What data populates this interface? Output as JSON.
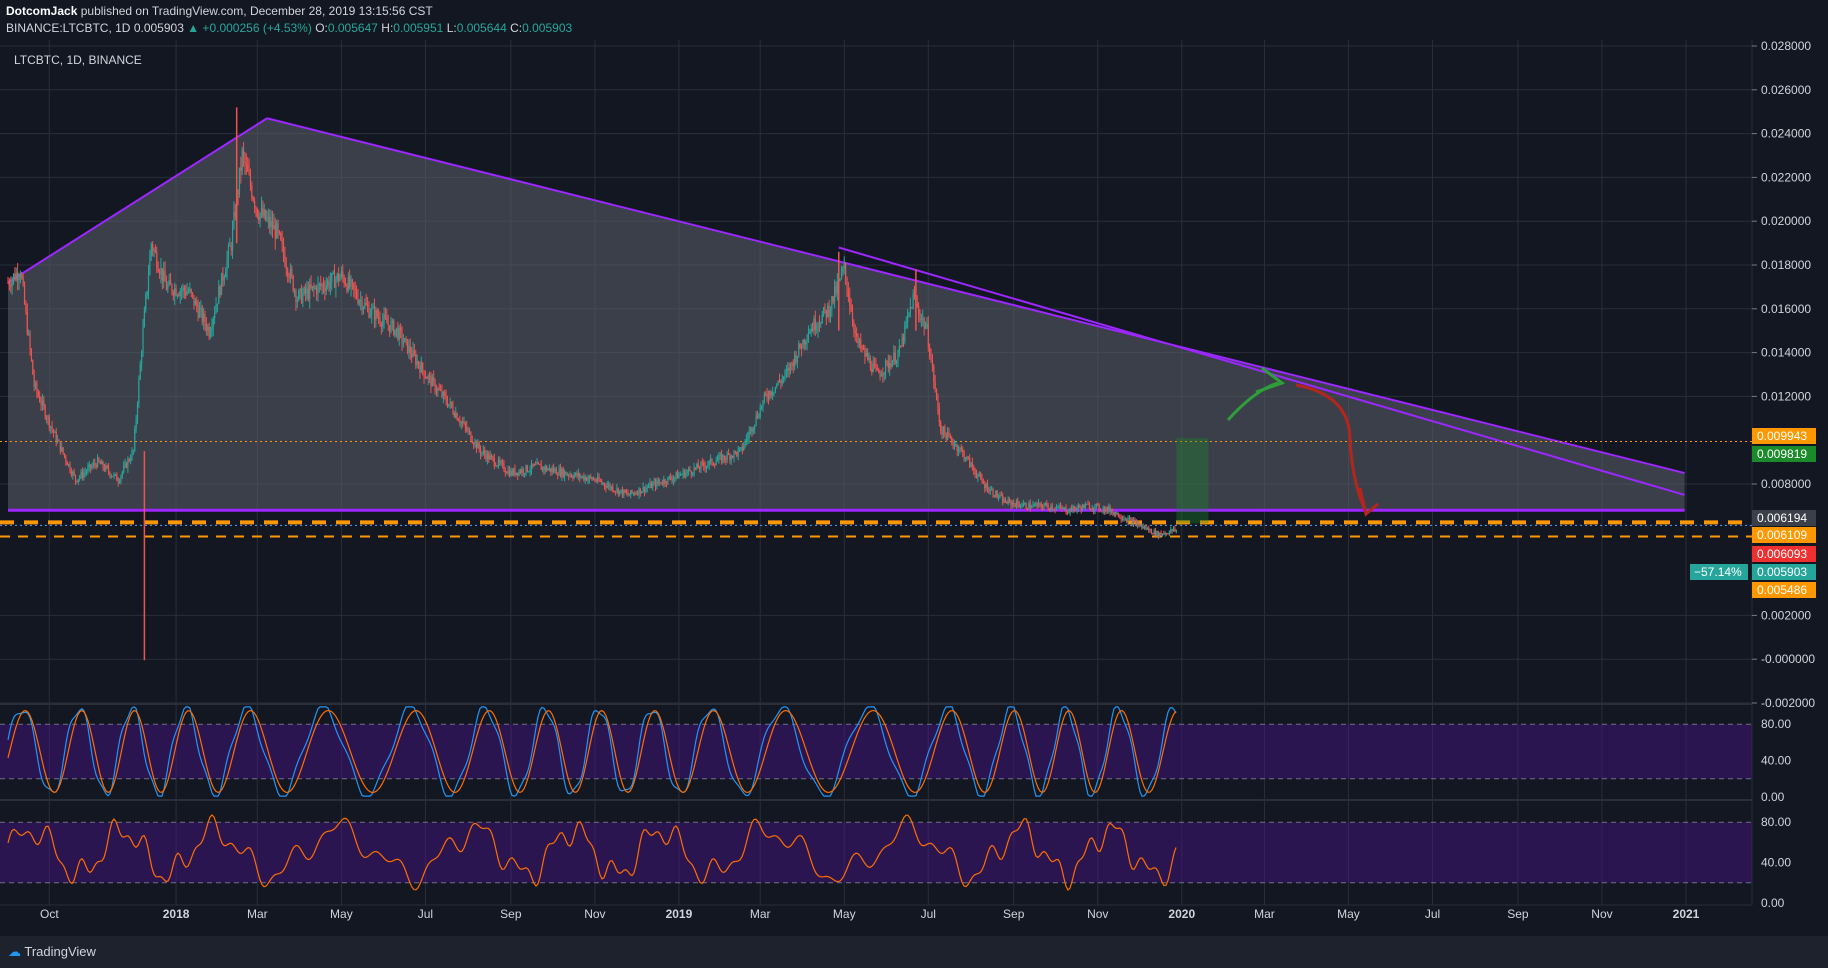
{
  "header": {
    "author": "DotcomJack",
    "published_text": "published on TradingView.com, December 28, 2019 13:15:56 CST",
    "symbol_line": "BINANCE:LTCBTC, 1D",
    "last_price": "0.005903",
    "change": "▲ +0.000256 (+4.53%)",
    "o_label": "O:",
    "o_value": "0.005647",
    "h_label": "H:",
    "h_value": "0.005951",
    "l_label": "L:",
    "l_value": "0.005644",
    "c_label": "C:",
    "c_value": "0.005903"
  },
  "legend": {
    "pane_title": "LTCBTC, 1D, BINANCE"
  },
  "footer": {
    "brand": "TradingView"
  },
  "colors": {
    "background": "#131722",
    "grid": "#2a2e39",
    "triangle_line": "#9c27ff",
    "triangle_fill": "#5d606b",
    "orange": "#ff9800",
    "up": "#26a69a",
    "down": "#ef5350",
    "stoch_k": "#2196f3",
    "stoch_d": "#ff6d00",
    "rsi": "#ff6d00",
    "band": "#4a148c"
  },
  "chart_data": [
    {
      "type": "candlestick",
      "title": "LTCBTC, 1D, BINANCE",
      "ylim": [
        -0.002,
        0.028
      ],
      "y_ticks": [
        "0.028000",
        "0.026000",
        "0.024000",
        "0.022000",
        "0.020000",
        "0.018000",
        "0.016000",
        "0.014000",
        "0.012000",
        "0.008000",
        "0.002000",
        "-0.000000",
        "-0.002000"
      ],
      "x_ticks": [
        "Oct",
        "2018",
        "Mar",
        "May",
        "Jul",
        "Sep",
        "Nov",
        "2019",
        "Mar",
        "May",
        "Jul",
        "Sep",
        "Nov",
        "2020",
        "Mar",
        "May",
        "Jul",
        "Sep",
        "Nov",
        "2021"
      ],
      "x_tick_dates": [
        "2017-10-01",
        "2018-01-01",
        "2018-03-01",
        "2018-05-01",
        "2018-07-01",
        "2018-09-01",
        "2018-11-01",
        "2019-01-01",
        "2019-03-01",
        "2019-05-01",
        "2019-07-01",
        "2019-09-01",
        "2019-11-01",
        "2020-01-01",
        "2020-03-01",
        "2020-05-01",
        "2020-07-01",
        "2020-09-01",
        "2020-11-01",
        "2021-01-01"
      ],
      "price_path": [
        [
          "2017-09-01",
          0.0172
        ],
        [
          "2017-09-10",
          0.0178
        ],
        [
          "2017-09-20",
          0.0125
        ],
        [
          "2017-10-05",
          0.0102
        ],
        [
          "2017-10-20",
          0.0082
        ],
        [
          "2017-11-05",
          0.009
        ],
        [
          "2017-11-20",
          0.0082
        ],
        [
          "2017-12-01",
          0.0095
        ],
        [
          "2017-12-08",
          0.015
        ],
        [
          "2017-12-14",
          0.019
        ],
        [
          "2017-12-25",
          0.017
        ],
        [
          "2018-01-10",
          0.0168
        ],
        [
          "2018-01-25",
          0.015
        ],
        [
          "2018-02-10",
          0.019
        ],
        [
          "2018-02-18",
          0.023
        ],
        [
          "2018-03-01",
          0.0205
        ],
        [
          "2018-03-15",
          0.0195
        ],
        [
          "2018-03-30",
          0.0165
        ],
        [
          "2018-04-15",
          0.017
        ],
        [
          "2018-05-01",
          0.0175
        ],
        [
          "2018-05-20",
          0.016
        ],
        [
          "2018-06-10",
          0.015
        ],
        [
          "2018-07-01",
          0.013
        ],
        [
          "2018-07-20",
          0.0115
        ],
        [
          "2018-08-10",
          0.0095
        ],
        [
          "2018-09-01",
          0.0085
        ],
        [
          "2018-09-20",
          0.0088
        ],
        [
          "2018-10-10",
          0.0085
        ],
        [
          "2018-11-01",
          0.0082
        ],
        [
          "2018-11-25",
          0.0075
        ],
        [
          "2018-12-15",
          0.008
        ],
        [
          "2019-01-05",
          0.0085
        ],
        [
          "2019-01-25",
          0.009
        ],
        [
          "2019-02-15",
          0.0095
        ],
        [
          "2019-03-05",
          0.012
        ],
        [
          "2019-03-20",
          0.013
        ],
        [
          "2019-04-05",
          0.015
        ],
        [
          "2019-04-20",
          0.016
        ],
        [
          "2019-05-01",
          0.0178
        ],
        [
          "2019-05-10",
          0.0145
        ],
        [
          "2019-05-25",
          0.013
        ],
        [
          "2019-06-10",
          0.014
        ],
        [
          "2019-06-20",
          0.0165
        ],
        [
          "2019-06-30",
          0.015
        ],
        [
          "2019-07-10",
          0.0105
        ],
        [
          "2019-07-25",
          0.0095
        ],
        [
          "2019-08-10",
          0.008
        ],
        [
          "2019-08-25",
          0.0072
        ],
        [
          "2019-09-10",
          0.007
        ],
        [
          "2019-09-25",
          0.007
        ],
        [
          "2019-10-10",
          0.0068
        ],
        [
          "2019-10-25",
          0.007
        ],
        [
          "2019-11-10",
          0.0068
        ],
        [
          "2019-11-25",
          0.0063
        ],
        [
          "2019-12-15",
          0.0057
        ],
        [
          "2019-12-28",
          0.005903
        ]
      ],
      "spikes": [
        {
          "date": "2017-12-09",
          "low": -5e-05,
          "high": 0.0095
        },
        {
          "date": "2018-02-14",
          "low": 0.019,
          "high": 0.0252
        },
        {
          "date": "2019-04-27",
          "low": 0.015,
          "high": 0.0186
        },
        {
          "date": "2019-06-22",
          "low": 0.015,
          "high": 0.0178
        }
      ],
      "triangle": {
        "vertices": [
          [
            "2017-09-01",
            0.0172
          ],
          [
            "2018-03-08",
            0.0247
          ],
          [
            "2020-12-31",
            0.0085
          ],
          [
            "2020-12-31",
            0.0068
          ],
          [
            "2017-09-01",
            0.0068
          ]
        ],
        "upper_inner_trendline": [
          [
            "2019-04-27",
            0.0188
          ],
          [
            "2020-12-31",
            0.0075
          ]
        ],
        "support_line": [
          [
            "2017-09-01",
            0.0068
          ],
          [
            "2020-12-31",
            0.0068
          ]
        ]
      },
      "horizontal_lines": [
        {
          "price": 0.009943,
          "style": "dotted",
          "color": "#ff9800"
        },
        {
          "price": 0.00625,
          "style": "dashed-thick",
          "color": "#ff9800"
        },
        {
          "price": 0.006109,
          "style": "dotted",
          "color": "#5b9cf6"
        },
        {
          "price": 0.0056,
          "style": "dashed",
          "color": "#ff9800"
        }
      ],
      "price_labels": [
        {
          "text": "0.009943",
          "bg": "#ff9800",
          "fg": "#ffffff",
          "price": 0.009943
        },
        {
          "text": "0.009819",
          "bg": "#1b8a2a",
          "fg": "#ffffff",
          "price": 0.009819
        },
        {
          "text": "0.006194",
          "bg": "#3b3f4a",
          "fg": "#ffffff",
          "price": 0.006194
        },
        {
          "text": "0.006109",
          "bg": "#ff9800",
          "fg": "#ffffff",
          "price": 0.006109
        },
        {
          "text": "0.006093",
          "bg": "#ef3030",
          "fg": "#ffffff",
          "price": 0.006093
        },
        {
          "text": "0.005903",
          "bg": "#26a69a",
          "fg": "#ffffff",
          "price": 0.005903,
          "tag": "−57.14%"
        },
        {
          "text": "0.005486",
          "bg": "#ff9800",
          "fg": "#ffffff",
          "price": 0.005486
        }
      ]
    },
    {
      "type": "line",
      "name_hidden": "stochastic",
      "ylim": [
        0,
        100
      ],
      "y_ticks": [
        "80.00",
        "40.00",
        "0.00"
      ],
      "band": [
        20,
        80
      ]
    },
    {
      "type": "line",
      "name_hidden": "rsi",
      "ylim": [
        0,
        100
      ],
      "y_ticks": [
        "80.00",
        "40.00",
        "0.00"
      ],
      "band": [
        20,
        80
      ]
    }
  ]
}
